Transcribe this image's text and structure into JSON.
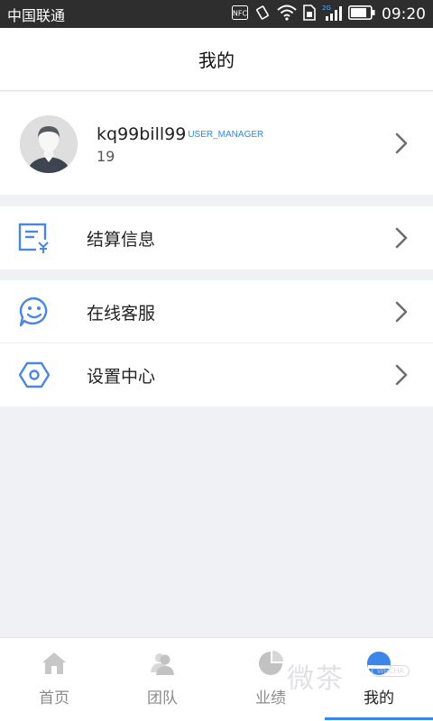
{
  "status_bar": {
    "carrier": "中国联通",
    "nfc": "NFC",
    "network": "2G",
    "time": "09:20"
  },
  "header": {
    "title": "我的"
  },
  "profile": {
    "username": "kq99bill99",
    "role": "USER_MANAGER",
    "id": "19"
  },
  "menu": [
    {
      "label": "结算信息",
      "icon": "settlement-icon"
    },
    {
      "label": "在线客服",
      "icon": "customer-service-icon"
    },
    {
      "label": "设置中心",
      "icon": "settings-icon"
    }
  ],
  "nav": [
    {
      "label": "首页",
      "icon": "home-icon"
    },
    {
      "label": "团队",
      "icon": "team-icon"
    },
    {
      "label": "业绩",
      "icon": "pie-chart-icon"
    },
    {
      "label": "我的",
      "icon": "profile-icon",
      "active": true
    }
  ],
  "watermark": {
    "text": "微茶",
    "badge": "WECHA"
  },
  "colors": {
    "accent": "#3b86e8",
    "role_text": "#2b8de0",
    "inactive": "#8a8a8a"
  }
}
